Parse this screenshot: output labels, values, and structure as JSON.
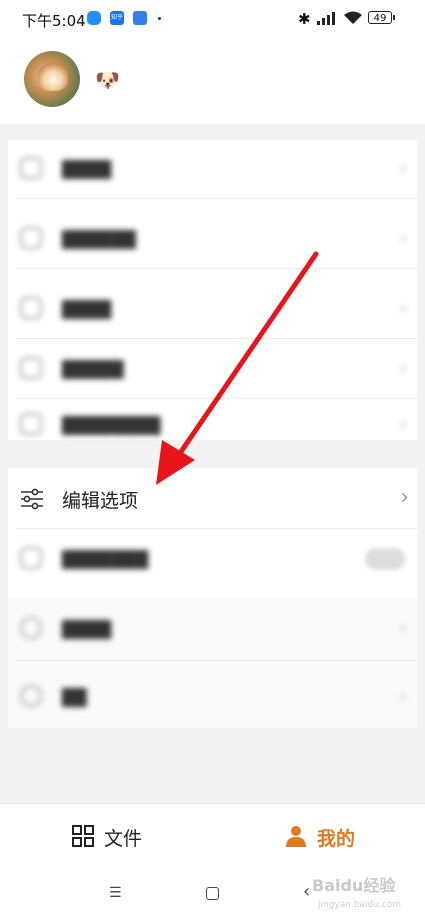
{
  "status_bar": {
    "time": "下午5:04",
    "zhihu_label": "知乎",
    "battery": "49"
  },
  "profile": {
    "nickname": "🐶"
  },
  "menu": {
    "edit_options_label": "编辑选项"
  },
  "bottom_nav": {
    "files_label": "文件",
    "me_label": "我的"
  },
  "system_nav": {
    "menu_glyph": "☰",
    "back_glyph": "‹"
  },
  "watermark": {
    "text": "Baidu经验",
    "url": "jingyan.baidu.com"
  },
  "colors": {
    "accent": "#e07a1f",
    "arrow": "#e8141c",
    "background": "#f3f3f3"
  },
  "icons": [
    "bluetooth-icon",
    "signal-icon",
    "wifi-icon",
    "battery-icon",
    "sliders-icon",
    "chevron-right-icon",
    "grid-icon",
    "person-icon",
    "red-arrow"
  ]
}
